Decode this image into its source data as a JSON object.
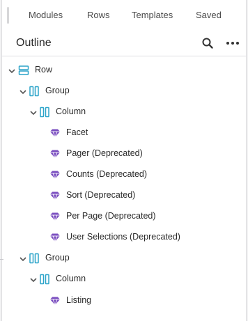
{
  "tabs": [
    "Modules",
    "Rows",
    "Templates",
    "Saved"
  ],
  "header": {
    "title": "Outline",
    "search_icon": "search-icon",
    "more_icon": "more-options-icon"
  },
  "colors": {
    "structure_icon": "#2ba4c9",
    "module_icon": "#7b4fc0",
    "chevron": "#555555"
  },
  "tree": {
    "row": "Row",
    "group1": "Group",
    "column1": "Column",
    "modules1": [
      "Facet",
      "Pager (Deprecated)",
      "Counts (Deprecated)",
      "Sort (Deprecated)",
      "Per Page (Deprecated)",
      "User Selections (Deprecated)"
    ],
    "group2": "Group",
    "column2": "Column",
    "modules2": [
      "Listing"
    ]
  }
}
